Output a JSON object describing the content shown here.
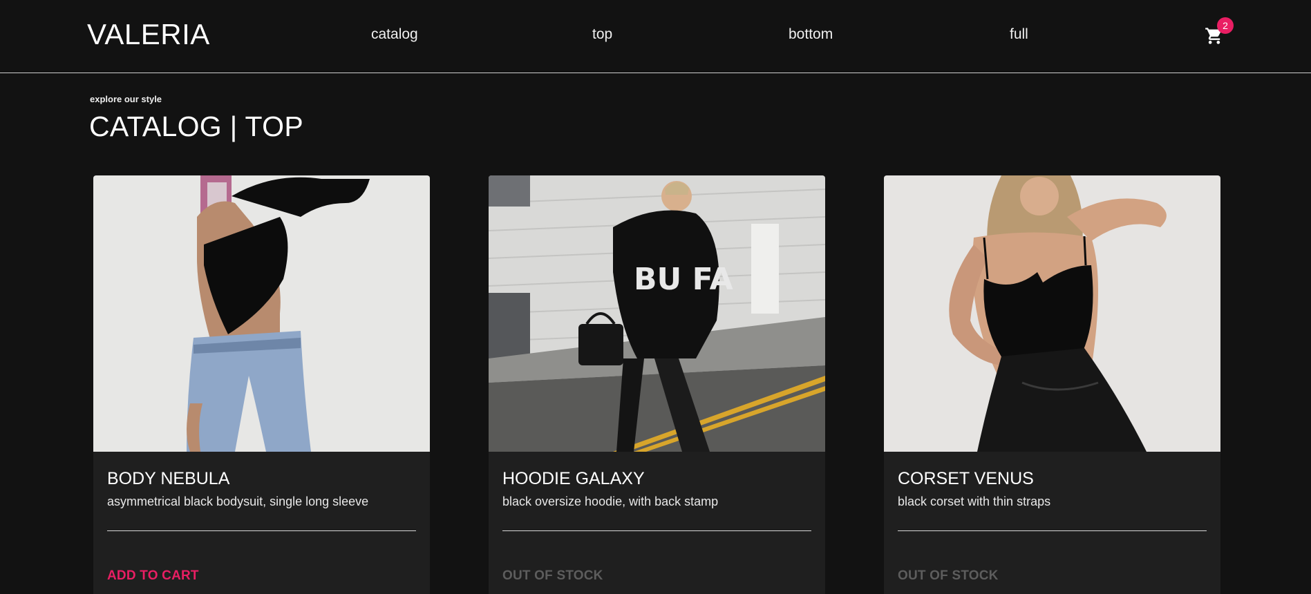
{
  "header": {
    "brand": "VALERIA",
    "nav": [
      "catalog",
      "top",
      "bottom",
      "full"
    ],
    "cart_icon": "shopping-cart-icon",
    "cart_count": "2"
  },
  "page": {
    "kicker": "explore our style",
    "title": "CATALOG | TOP"
  },
  "colors": {
    "accent": "#e91e63",
    "background": "#121212",
    "card": "#1f1f1f",
    "disabled": "#5d5d5d"
  },
  "products": [
    {
      "name": "BODY NEBULA",
      "description": "asymmetrical black bodysuit, single long sleeve",
      "action": "ADD TO CART",
      "in_stock": true
    },
    {
      "name": "HOODIE GALAXY",
      "description": "black oversize hoodie, with back stamp",
      "action": "OUT OF STOCK",
      "in_stock": false
    },
    {
      "name": "CORSET VENUS",
      "description": "black corset with thin straps",
      "action": "OUT OF STOCK",
      "in_stock": false
    }
  ]
}
